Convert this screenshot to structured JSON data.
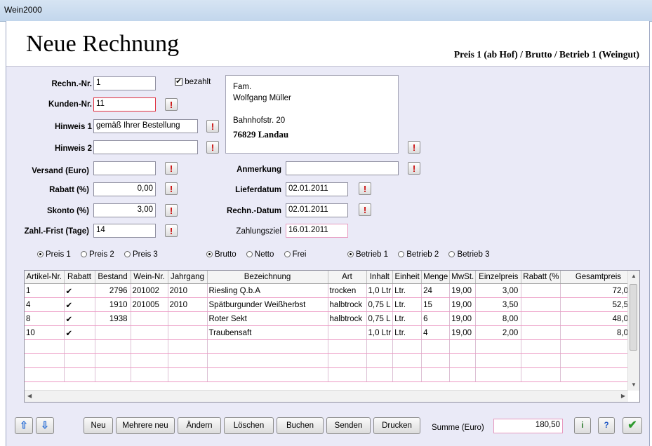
{
  "window": {
    "title": "Wein2000"
  },
  "header": {
    "title": "Neue Rechnung",
    "price_info": "Preis 1  (ab Hof) / Brutto / Betrieb 1  (Weingut)"
  },
  "form": {
    "rechn_nr": {
      "label": "Rechn.-Nr.",
      "value": "1"
    },
    "bezahlt": {
      "label": "bezahlt",
      "checked": true
    },
    "kunden_nr": {
      "label": "Kunden-Nr.",
      "value": "11"
    },
    "hinweis1": {
      "label": "Hinweis 1",
      "value": "gemäß Ihrer Bestellung"
    },
    "hinweis2": {
      "label": "Hinweis 2",
      "value": ""
    },
    "versand": {
      "label": "Versand (Euro)",
      "value": ""
    },
    "rabatt": {
      "label": "Rabatt (%)",
      "value": "0,00"
    },
    "skonto": {
      "label": "Skonto (%)",
      "value": "3,00"
    },
    "zahl_frist": {
      "label": "Zahl.-Frist (Tage)",
      "value": "14"
    },
    "anmerkung": {
      "label": "Anmerkung",
      "value": ""
    },
    "lieferdatum": {
      "label": "Lieferdatum",
      "value": "02.01.2011"
    },
    "rechn_datum": {
      "label": "Rechn.-Datum",
      "value": "02.01.2011"
    },
    "zahlungsziel": {
      "label": "Zahlungsziel",
      "value": "16.01.2011"
    },
    "address": {
      "line1": "Fam.",
      "line2": "Wolfgang Müller",
      "line3": "Bahnhofstr. 20",
      "city": "76829 Landau"
    },
    "alert_symbol": "!"
  },
  "radios": {
    "price": [
      {
        "label": "Preis 1",
        "selected": true
      },
      {
        "label": "Preis 2",
        "selected": false
      },
      {
        "label": "Preis 3",
        "selected": false
      }
    ],
    "tax": [
      {
        "label": "Brutto",
        "selected": true
      },
      {
        "label": "Netto",
        "selected": false
      },
      {
        "label": "Frei",
        "selected": false
      }
    ],
    "business": [
      {
        "label": "Betrieb 1",
        "selected": true
      },
      {
        "label": "Betrieb 2",
        "selected": false
      },
      {
        "label": "Betrieb 3",
        "selected": false
      }
    ]
  },
  "table": {
    "columns": [
      "Artikel-Nr.",
      "Rabatt",
      "Bestand",
      "Wein-Nr.",
      "Jahrgang",
      "Bezeichnung",
      "Art",
      "Inhalt",
      "Einheit",
      "Menge",
      "MwSt.",
      "Einzelpreis",
      "Rabatt (%",
      "Gesamtpreis"
    ],
    "rows": [
      [
        "1",
        "✔",
        "2796",
        "201002",
        "2010",
        "Riesling Q.b.A",
        "trocken",
        "1,0 Ltr",
        "Ltr.",
        "24",
        "19,00",
        "3,00",
        "",
        "72,00"
      ],
      [
        "4",
        "✔",
        "1910",
        "201005",
        "2010",
        "Spätburgunder Weißherbst",
        "halbtrock",
        "0,75 L",
        "Ltr.",
        "15",
        "19,00",
        "3,50",
        "",
        "52,50"
      ],
      [
        "8",
        "✔",
        "1938",
        "",
        "",
        "Roter Sekt",
        "halbtrock",
        "0,75 L",
        "Ltr.",
        "6",
        "19,00",
        "8,00",
        "",
        "48,00"
      ],
      [
        "10",
        "✔",
        "",
        "",
        "",
        "Traubensaft",
        "",
        "1,0 Ltr",
        "Ltr.",
        "4",
        "19,00",
        "2,00",
        "",
        "8,00"
      ],
      [
        "",
        "",
        "",
        "",
        "",
        "",
        "",
        "",
        "",
        "",
        "",
        "",
        "",
        ""
      ],
      [
        "",
        "",
        "",
        "",
        "",
        "",
        "",
        "",
        "",
        "",
        "",
        "",
        "",
        ""
      ],
      [
        "",
        "",
        "",
        "",
        "",
        "",
        "",
        "",
        "",
        "",
        "",
        "",
        "",
        ""
      ]
    ]
  },
  "buttons": {
    "up": "⇧",
    "down": "⇩",
    "neu": "Neu",
    "mehrere_neu": "Mehrere neu",
    "aendern": "Ändern",
    "loeschen": "Löschen",
    "buchen": "Buchen",
    "senden": "Senden",
    "drucken": "Drucken"
  },
  "summe": {
    "label": "Summe (Euro)",
    "value": "180,50"
  },
  "footer_icons": {
    "info": "i",
    "help": "?",
    "ok": "✔"
  }
}
